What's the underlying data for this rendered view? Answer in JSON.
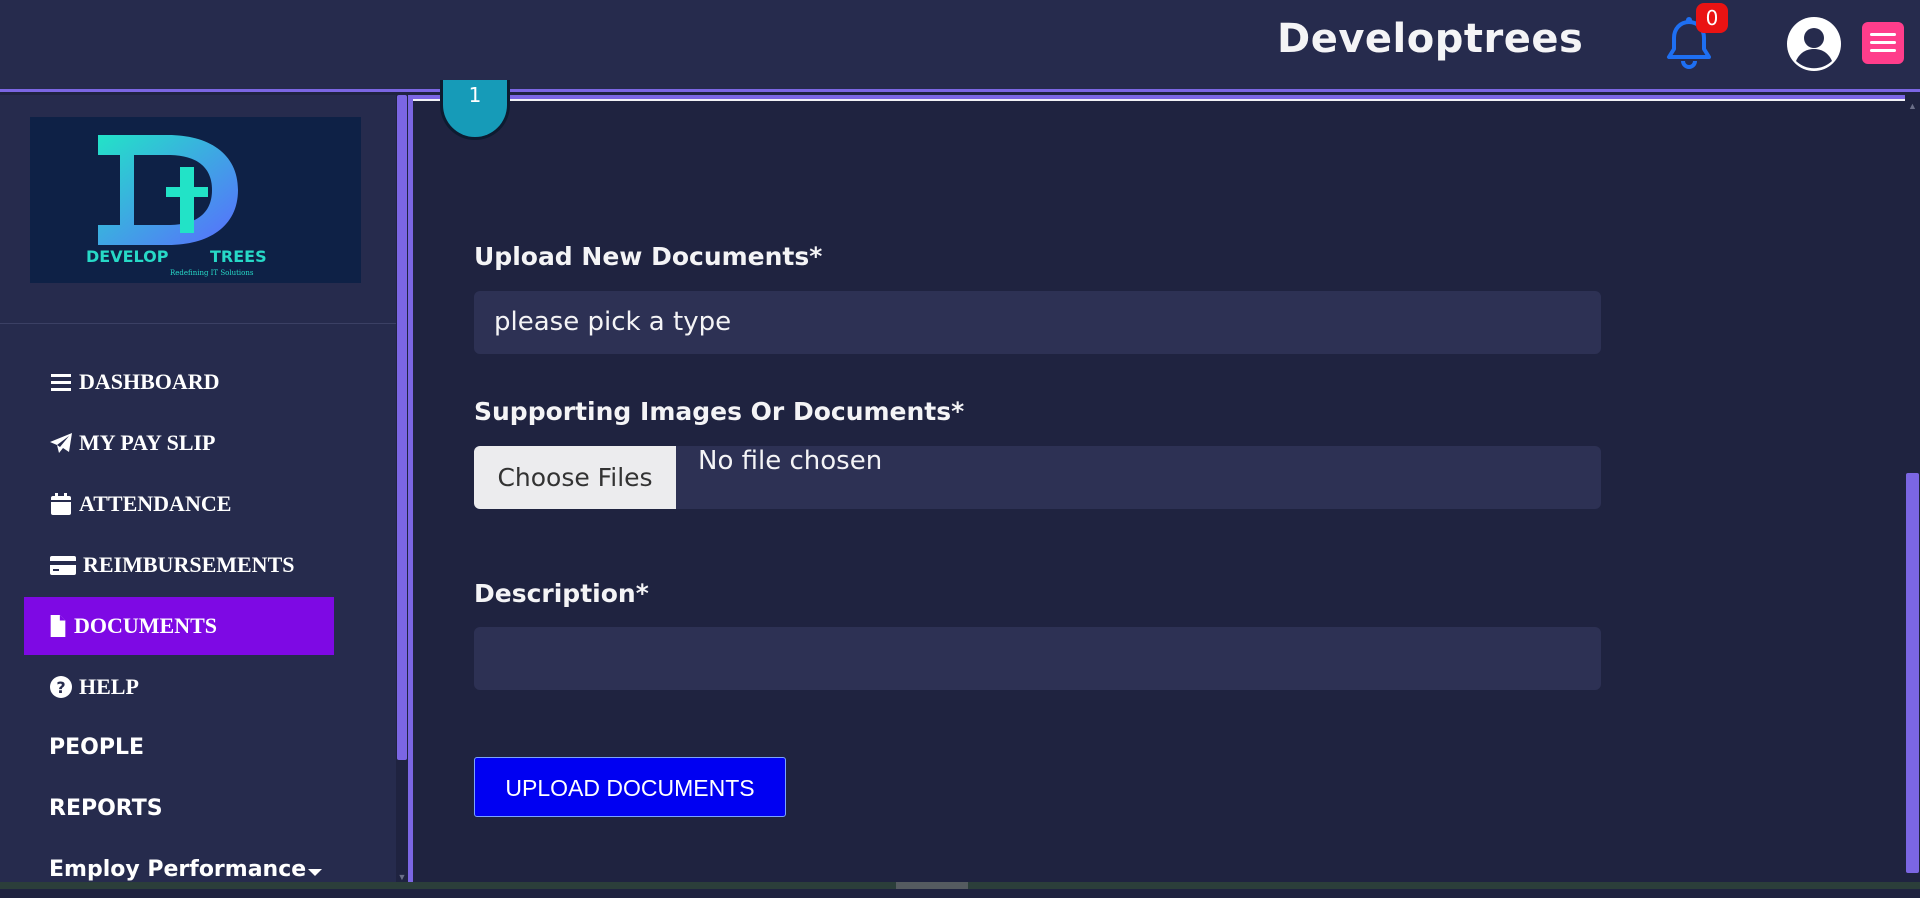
{
  "header": {
    "brand": "Developtrees",
    "notification_count": "0",
    "accent_color": "#7b66e3",
    "icons": [
      "bell-icon",
      "user-avatar-icon",
      "hamburger-menu-icon"
    ]
  },
  "sidebar": {
    "logo_text": "DEVELOP",
    "logo_text2": "TREES",
    "logo_tagline": "Redefining IT Solutions",
    "items": [
      {
        "label": "DASHBOARD",
        "icon": "list-icon"
      },
      {
        "label": "MY PAY SLIP",
        "icon": "paper-plane-icon"
      },
      {
        "label": "ATTENDANCE",
        "icon": "calendar-icon"
      },
      {
        "label": "REIMBURSEMENTS",
        "icon": "credit-card-icon"
      },
      {
        "label": "DOCUMENTS",
        "icon": "file-icon",
        "active": true
      },
      {
        "label": "HELP",
        "icon": "question-circle-icon"
      },
      {
        "label": "PEOPLE"
      },
      {
        "label": "REPORTS"
      },
      {
        "label": "Employ Performance",
        "icon": "caret-down-icon"
      }
    ],
    "active_color": "#7e09e4"
  },
  "form": {
    "step_number": "1",
    "upload_label": "Upload New Documents*",
    "type_select_value": "please pick a type",
    "supporting_label": "Supporting Images Or Documents*",
    "choose_files_label": "Choose Files",
    "no_file_text": "No file chosen",
    "description_label": "Description*",
    "description_value": "",
    "submit_label": "UPLOAD DOCUMENTS",
    "submit_color": "#0000f2"
  }
}
